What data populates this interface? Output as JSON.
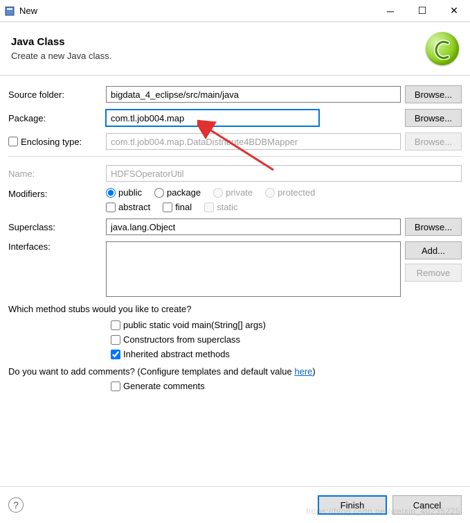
{
  "window": {
    "title": "New"
  },
  "header": {
    "title": "Java Class",
    "description": "Create a new Java class."
  },
  "form": {
    "sourceFolder": {
      "label": "Source folder:",
      "value": "bigdata_4_eclipse/src/main/java",
      "browse": "Browse..."
    },
    "package": {
      "label": "Package:",
      "value": "com.tl.job004.map",
      "browse": "Browse..."
    },
    "enclosingType": {
      "label": "Enclosing type:",
      "value": "com.tl.job004.map.DataDistribute4BDBMapper",
      "browse": "Browse..."
    },
    "name": {
      "label": "Name:",
      "value": "HDFSOperatorUtil"
    },
    "modifiers": {
      "label": "Modifiers:",
      "radios": {
        "public": "public",
        "package": "package",
        "private": "private",
        "protected": "protected"
      },
      "checks": {
        "abstract": "abstract",
        "final": "final",
        "static": "static"
      }
    },
    "superclass": {
      "label": "Superclass:",
      "value": "java.lang.Object",
      "browse": "Browse..."
    },
    "interfaces": {
      "label": "Interfaces:",
      "add": "Add...",
      "remove": "Remove"
    },
    "stubs": {
      "question": "Which method stubs would you like to create?",
      "main": "public static void main(String[] args)",
      "constructors": "Constructors from superclass",
      "inherited": "Inherited abstract methods"
    },
    "comments": {
      "question_prefix": "Do you want to add comments? (Configure templates and default value ",
      "link": "here",
      "question_suffix": ")",
      "generate": "Generate comments"
    }
  },
  "footer": {
    "finish": "Finish",
    "cancel": "Cancel"
  },
  "watermark": "https://blog.csdn.net/weixin_40235225"
}
